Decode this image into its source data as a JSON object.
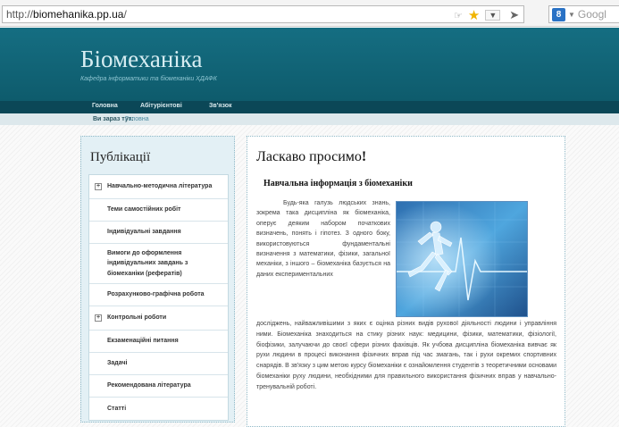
{
  "browser": {
    "url_scheme": "http://",
    "url_host": "biomehanika.pp.ua",
    "url_path": "/",
    "search_placeholder": "Googl"
  },
  "site": {
    "title": "Біомеханіка",
    "subtitle": "Кафедра інформатики та біомеханіки ХДАФК"
  },
  "nav": {
    "items": [
      "Головна",
      "Абітурієнтові",
      "Зв'язок"
    ]
  },
  "breadcrumb": {
    "label": "Ви зараз тут:",
    "link": "Головна"
  },
  "sidebar": {
    "title": "Публікації",
    "items": [
      {
        "label": "Навчально-методична література",
        "expandable": true
      },
      {
        "label": "Теми самостійних робіт",
        "expandable": false
      },
      {
        "label": "Індивідуальні завдання",
        "expandable": false
      },
      {
        "label": "Вимоги до оформлення індивідуальних завдань з біомеханіки (рефератів)",
        "expandable": false
      },
      {
        "label": "Розрахунково-графічна робота",
        "expandable": false
      },
      {
        "label": "Контрольні роботи",
        "expandable": true
      },
      {
        "label": "Екзаменаційні питання",
        "expandable": false
      },
      {
        "label": "Задачі",
        "expandable": false
      },
      {
        "label": "Рекомендована література",
        "expandable": false
      },
      {
        "label": "Статті",
        "expandable": false
      }
    ]
  },
  "main": {
    "title": "Ласкаво просимо",
    "title_mark": "!",
    "subheading": "Навчальна інформація з біомеханіки",
    "intro_text": "Будь-яка галузь людських знань, зокрема така дисципліна як біомеханіка, оперує деяким набором початкових визначень, понять і гіпотез. З одного боку, використовуються фундаментальні визначення з математики, фізики, загальної механіки, з іншого – біомеханіка базується на даних експериментальних",
    "body_text": "досліджень, найважливішими з яких є оцінка різних видів рухової діяльності людини і управління ними. Біомеханіка знаходиться на стику різних наук: медицини, фізики, математики, фізіології, біофізики, залучаючи до своєї сфери різних фахівців. Як учбова дисципліна біомеханіка вивчає як рухи людини в процесі виконання фізичних вправ під час змагань, так і рухи окремих спортивних снарядів. В зв'язку з цим метою курсу біомеханіки є ознайомлення студентів з теоретичними основами біомеханіки руху людини, необхідними для правильного використання фізичних вправ у навчально-тренувальній роботі."
  }
}
